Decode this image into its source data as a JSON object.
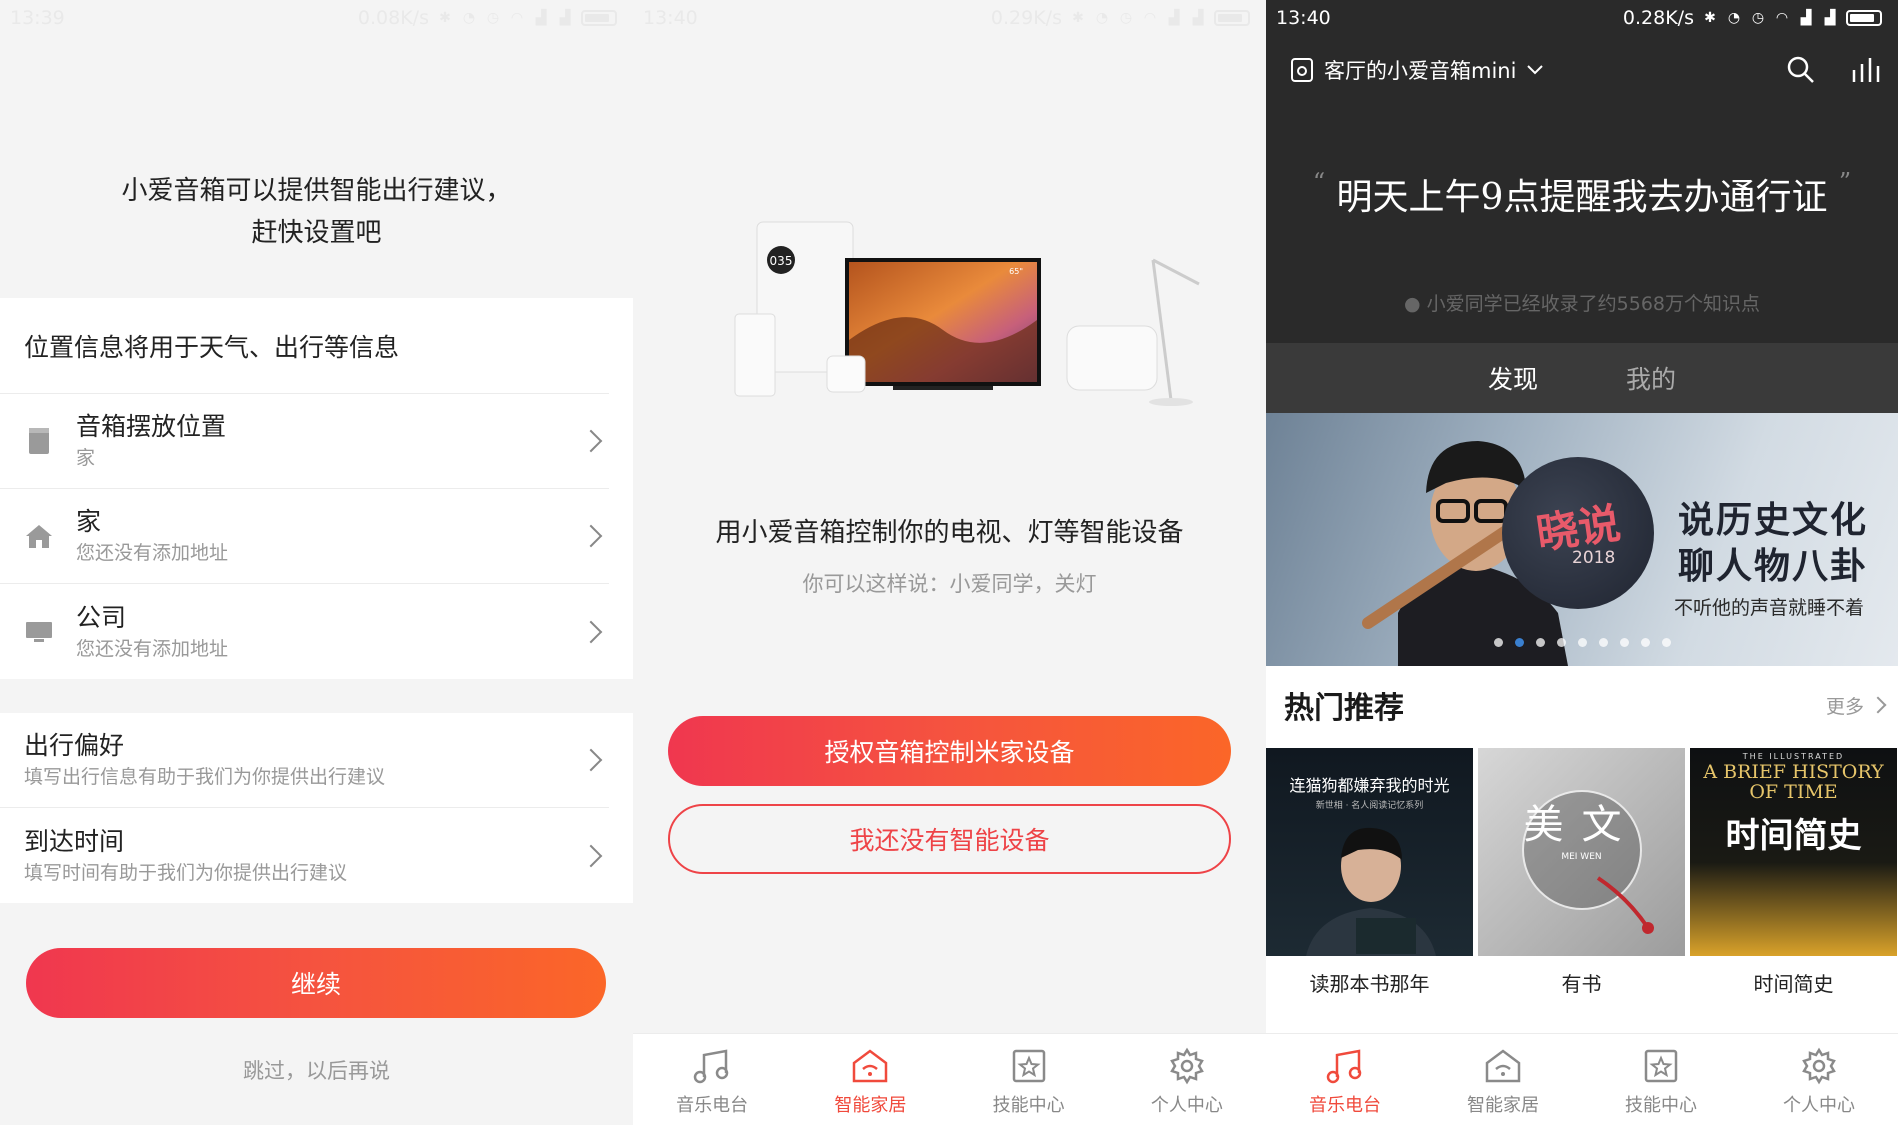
{
  "screen1": {
    "status": {
      "time": "13:39",
      "speed": "0.08K/s"
    },
    "intro_line1": "小爱音箱可以提供智能出行建议，",
    "intro_line2": "赶快设置吧",
    "location_card": {
      "header": "位置信息将用于天气、出行等信息",
      "items": [
        {
          "title": "音箱摆放位置",
          "subtitle": "家",
          "icon": "speaker-icon"
        },
        {
          "title": "家",
          "subtitle": "您还没有添加地址",
          "icon": "home-icon"
        },
        {
          "title": "公司",
          "subtitle": "您还没有添加地址",
          "icon": "office-icon"
        }
      ]
    },
    "travel_card": {
      "items": [
        {
          "title": "出行偏好",
          "subtitle": "填写出行信息有助于我们为你提供出行建议"
        },
        {
          "title": "到达时间",
          "subtitle": "填写时间有助于我们为你提供出行建议"
        }
      ]
    },
    "continue_label": "继续",
    "skip_label": "跳过，以后再说"
  },
  "screen2": {
    "status": {
      "time": "13:40",
      "speed": "0.29K/s"
    },
    "device_badge": "035",
    "tv_size": "65\"",
    "title": "用小爱音箱控制你的电视、灯等智能设备",
    "subtitle": "你可以这样说：小爱同学，关灯",
    "authorize_label": "授权音箱控制米家设备",
    "no_device_label": "我还没有智能设备",
    "tabs": [
      {
        "label": "音乐电台",
        "icon": "music-icon",
        "active": false
      },
      {
        "label": "智能家居",
        "icon": "smart-home-icon",
        "active": true
      },
      {
        "label": "技能中心",
        "icon": "skill-star-icon",
        "active": false
      },
      {
        "label": "个人中心",
        "icon": "gear-icon",
        "active": false
      }
    ]
  },
  "screen3": {
    "status": {
      "time": "13:40",
      "speed": "0.28K/s"
    },
    "device_name": "客厅的小爱音箱mini",
    "quote": "明天上午9点提醒我去办通行证",
    "knowledge": "小爱同学已经收录了约5568万个知识点",
    "tabs": [
      {
        "label": "发现",
        "active": true
      },
      {
        "label": "我的",
        "active": false
      }
    ],
    "banner": {
      "seal": "晓说",
      "year": "2018",
      "line1": "说历史文化",
      "line2": "聊人物八卦",
      "line3": "不听他的声音就睡不着",
      "dot_count": 9,
      "active_dot": 1
    },
    "hot_title": "热门推荐",
    "more_label": "更多",
    "books": [
      {
        "cover_title": "连猫狗都嫌弃我的时光",
        "cover_sub": "新世相 · 名人阅读记忆系列",
        "caption": "读那本书那年"
      },
      {
        "cover_title": "美文",
        "cover_sub": "MEI WEN",
        "caption": "有书"
      },
      {
        "cover_title": "A BRIEF HISTORY OF TIME",
        "cover_sub": "时间简史",
        "cover_top": "THE ILLUSTRATED",
        "caption": "时间简史"
      }
    ],
    "tabs_bottom": [
      {
        "label": "音乐电台",
        "icon": "music-icon",
        "active": true
      },
      {
        "label": "智能家居",
        "icon": "smart-home-icon",
        "active": false
      },
      {
        "label": "技能中心",
        "icon": "skill-star-icon",
        "active": false
      },
      {
        "label": "个人中心",
        "icon": "gear-icon",
        "active": false
      }
    ]
  },
  "colors": {
    "accent": "#f04a3c",
    "gradient_start": "#f0374f",
    "gradient_end": "#fb6628",
    "dark_bg": "#2a2a2a"
  }
}
